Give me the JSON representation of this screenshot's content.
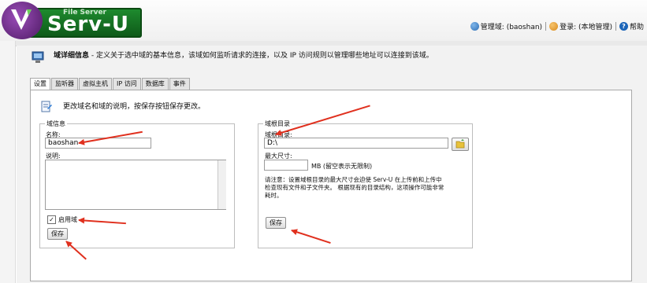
{
  "header": {
    "logo_subtitle": "File Server",
    "logo_title": "Serv-U",
    "links": [
      {
        "label": "管理域: (baoshan)",
        "icon": "globe-icon",
        "color": "#2f6fb5"
      },
      {
        "label": "登录: (本地管理)",
        "icon": "user-icon",
        "color": "#d98a1c"
      },
      {
        "label": "帮助",
        "icon": "help-icon",
        "color": "#1c65b8"
      }
    ]
  },
  "page": {
    "info_title": "域详细信息",
    "info_desc": " - 定义关于选中域的基本信息，该域如何监听请求的连接，以及 IP 访问规则以管理哪些地址可以连接到该域。"
  },
  "tabs": [
    {
      "label": "设置",
      "active": true
    },
    {
      "label": "监听器",
      "active": false
    },
    {
      "label": "虚拟主机",
      "active": false
    },
    {
      "label": "IP 访问",
      "active": false
    },
    {
      "label": "数据库",
      "active": false
    },
    {
      "label": "事件",
      "active": false
    }
  ],
  "settings": {
    "description": "更改域名和域的说明，按保存按钮保存更改。",
    "domain_info": {
      "legend": "域信息",
      "name_label": "名称:",
      "name_value": "baoshan",
      "desc_label": "说明:",
      "desc_value": "",
      "enable_label": "启用域",
      "enabled": true,
      "save_label": "保存"
    },
    "root_dir": {
      "legend": "域根目录",
      "dir_label": "域根目录:",
      "dir_value": "D:\\",
      "max_size_label": "最大尺寸:",
      "max_size_value": "",
      "max_size_unit": "MB (留空表示无限制)",
      "note": "请注意：设置域根目录的最大尺寸会迫使 Serv-U 在上传前和上传中检查现有文件和子文件夹。 根据现有的目录结构，这项操作可能非常耗时。",
      "save_label": "保存"
    }
  },
  "colors": {
    "annotation_arrow": "#e0301e",
    "logo_green": "#1e8a2e",
    "logo_purple": "#6a2a86"
  }
}
